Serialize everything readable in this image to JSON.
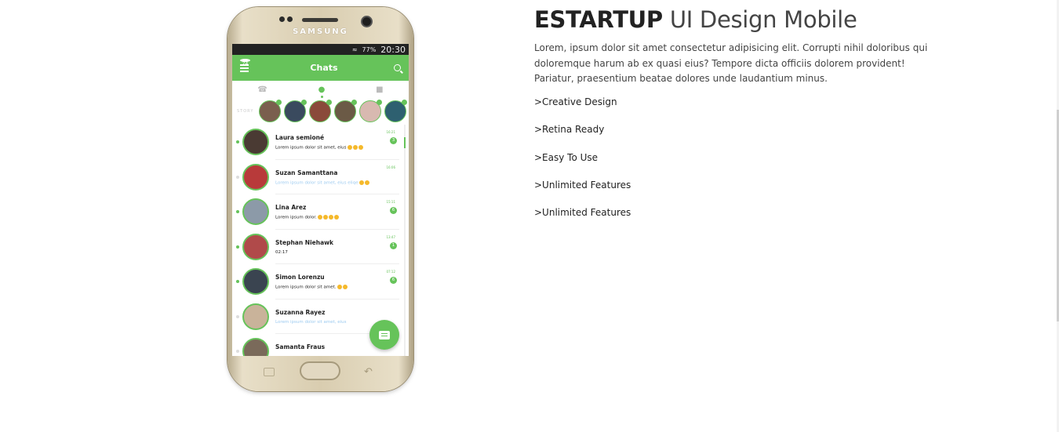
{
  "section": {
    "title_bold": "ESTARTUP",
    "title_light": "UI Design Mobile",
    "description": "Lorem, ipsum dolor sit amet consectetur adipisicing elit. Corrupti nihil doloribus qui doloremque harum ab ex quasi eius? Tempore dicta officiis dolorem provident! Pariatur, praesentium beatae dolores unde laudantium minus.",
    "features": [
      ">Creative Design",
      ">Retina Ready",
      ">Easy To Use",
      ">Unlimited Features",
      ">Unlimited Features"
    ]
  },
  "phone": {
    "brand": "SAMSUNG",
    "status_battery": "77%",
    "status_time": "20:30",
    "app": {
      "title": "Chats",
      "menu_badge": "24",
      "story_label": "STORY",
      "stories": [
        {
          "color": "#7a5f4e"
        },
        {
          "color": "#3a4a5e"
        },
        {
          "color": "#8a4a3a"
        },
        {
          "color": "#6b5a46"
        },
        {
          "color": "#d8b9b0"
        },
        {
          "color": "#2e6070"
        }
      ],
      "chats": [
        {
          "name": "Laura semioné",
          "message": "Lorem ipsum dolor sit amet, eius",
          "emoji_count": 3,
          "time": "16:21",
          "unread": "3",
          "online": true,
          "muted": false,
          "avatar_color": "#4a3a33"
        },
        {
          "name": "Suzan Samanttana",
          "message": "Lorem ipsum dolor sit amet, eius eliqe",
          "emoji_count": 2,
          "time": "16:06",
          "unread": "",
          "online": false,
          "muted": true,
          "avatar_color": "#b83a3a"
        },
        {
          "name": "Lina Arez",
          "message": "Lorem ipsum dolor.",
          "emoji_count": 4,
          "time": "15:11",
          "unread": "6",
          "online": true,
          "muted": false,
          "avatar_color": "#8c9aa8"
        },
        {
          "name": "Stephan Niehawk",
          "message": "02:17",
          "emoji_count": 0,
          "time": "13:47",
          "unread": "1",
          "online": true,
          "muted": false,
          "avatar_color": "#b04a4a"
        },
        {
          "name": "Simon Lorenzu",
          "message": "Lorem ipsum dolor sit amet.",
          "emoji_count": 2,
          "time": "07:12",
          "unread": "6",
          "online": true,
          "muted": false,
          "avatar_color": "#3a4450"
        },
        {
          "name": "Suzanna Rayez",
          "message": "Lorem ipsum dolor sit amet, eius",
          "emoji_count": 0,
          "time": "",
          "unread": "",
          "online": false,
          "muted": true,
          "avatar_color": "#c9b39a"
        },
        {
          "name": "Samanta Fraus",
          "message": "",
          "emoji_count": 0,
          "time": "",
          "unread": "",
          "online": false,
          "muted": false,
          "avatar_color": "#7a6a5a"
        }
      ]
    }
  }
}
